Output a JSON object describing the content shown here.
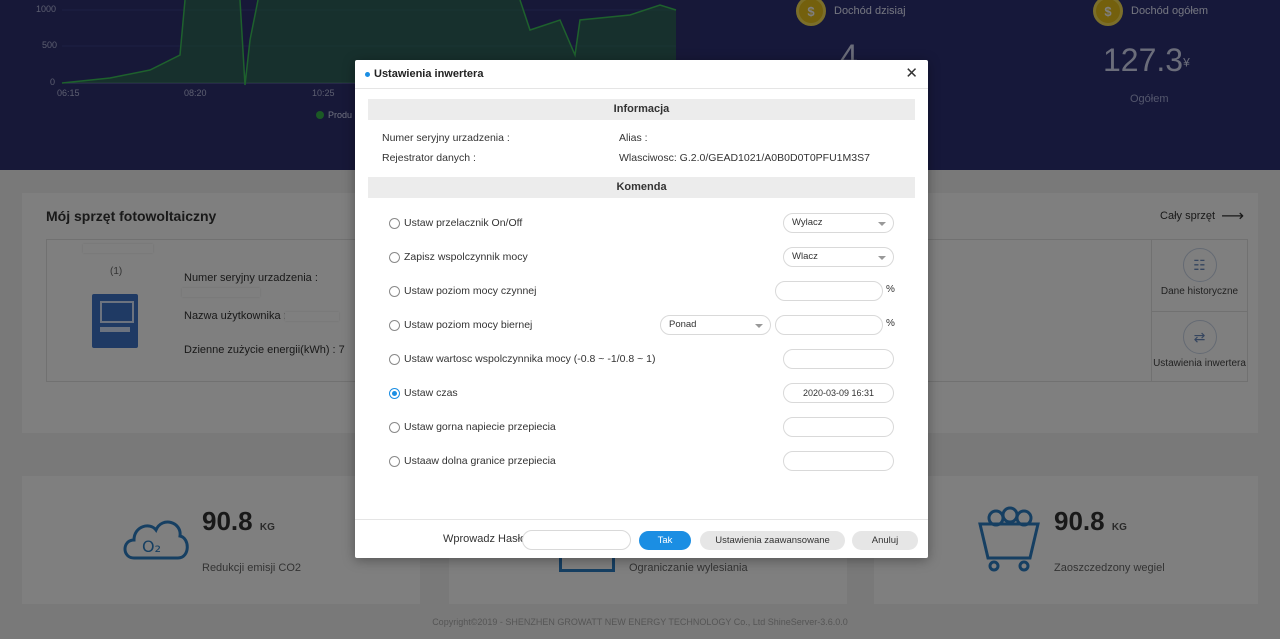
{
  "background": {
    "chart": {
      "y_ticks": [
        "1000",
        "500",
        "0"
      ],
      "x_ticks": [
        "06:15",
        "08:20",
        "10:25"
      ],
      "legend_label": "Produ"
    },
    "stats": [
      {
        "icon": "coin-icon",
        "label": "Dochód dzisiaj",
        "value": "4",
        "unit": "",
        "caption": ""
      },
      {
        "icon": "coin-icon",
        "label": "Dochód ogółem",
        "value": "127.3",
        "unit": "¥",
        "caption": "Ogółem"
      }
    ],
    "device_section": {
      "title": "Mój sprzęt fotowoltaiczny",
      "all_link": "Cały sprzęt",
      "count": "(1)",
      "fields": [
        "Numer seryjny urzadzenia :",
        "Nazwa użytkownika :",
        "Dzienne zużycie energii(kWh) : 7"
      ],
      "side_buttons": [
        {
          "icon": "history-icon",
          "label": "Dane historyczne"
        },
        {
          "icon": "settings-sliders-icon",
          "label": "Ustawienia inwertera"
        }
      ]
    },
    "eco": [
      {
        "icon": "co2-cloud-icon",
        "value": "90.8",
        "unit": "KG",
        "caption": "Redukcji emisji CO2"
      },
      {
        "icon": "tree-icon",
        "value": "",
        "unit": "",
        "caption": "Ograniczanie wylesiania"
      },
      {
        "icon": "coal-cart-icon",
        "value": "90.8",
        "unit": "KG",
        "caption": "Zaoszczedzony wegiel"
      }
    ],
    "footer": "Copyright©2019 - SHENZHEN GROWATT NEW ENERGY TECHNOLOGY Co., Ltd ShineServer-3.6.0.0"
  },
  "modal": {
    "title": "Ustawienia inwertera",
    "info_header": "Informacja",
    "info": {
      "serial_label": "Numer seryjny urzadzenia :",
      "alias_label": "Alias :",
      "logger_label": "Rejestrator danych :",
      "owner_label": "Wlasciwosc: G.2.0/GEAD1021/A0B0D0T0PFU1M3S7"
    },
    "command_header": "Komenda",
    "commands": [
      {
        "label": "Ustaw przelacznik On/Off",
        "control": "select",
        "value": "Wylacz",
        "checked": false
      },
      {
        "label": "Zapisz wspolczynnik mocy",
        "control": "select",
        "value": "Wlacz",
        "checked": false
      },
      {
        "label": "Ustaw poziom mocy czynnej",
        "control": "input",
        "value": "",
        "suffix": "%",
        "checked": false
      },
      {
        "label": "Ustaw poziom mocy biernej",
        "control": "select+input",
        "select_value": "Ponad",
        "value": "",
        "suffix": "%",
        "checked": false
      },
      {
        "label": "Ustaw wartosc wspolczynnika mocy (-0.8 ~ -1/0.8 ~ 1)",
        "control": "input",
        "value": "",
        "checked": false
      },
      {
        "label": "Ustaw czas",
        "control": "input",
        "value": "2020-03-09 16:31",
        "checked": true
      },
      {
        "label": "Ustaw gorna napiecie przepiecia",
        "control": "input",
        "value": "",
        "checked": false
      },
      {
        "label": "Ustaaw dolna granice przepiecia",
        "control": "input",
        "value": "",
        "checked": false
      }
    ],
    "footer": {
      "password_label": "Wprowadz Hasło",
      "password_value": "",
      "ok_label": "Tak",
      "advanced_label": "Ustawienia zaawansowane",
      "cancel_label": "Anuluj"
    }
  }
}
